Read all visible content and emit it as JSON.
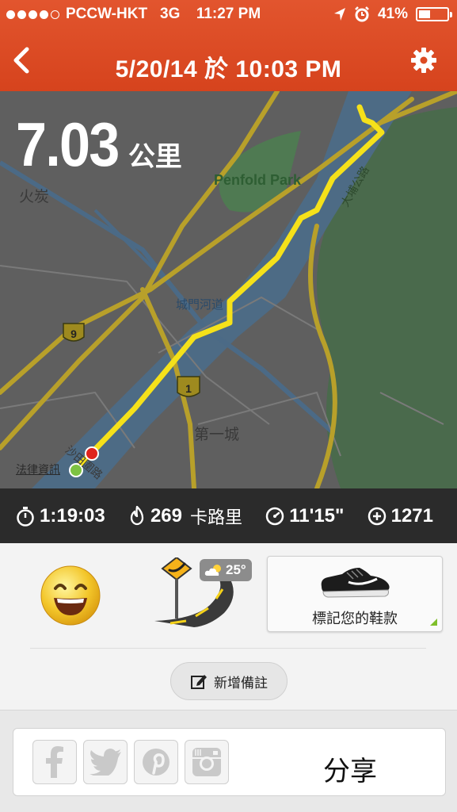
{
  "status_bar": {
    "carrier": "PCCW-HKT",
    "network": "3G",
    "time": "11:27 PM",
    "battery": "41%",
    "battery_level": 0.41,
    "signal_bars": 4,
    "icons": [
      "location-arrow-icon",
      "alarm-icon",
      "battery-icon"
    ]
  },
  "header": {
    "title": "5/20/14 於 10:03 PM",
    "back_icon": "chevron-left-icon",
    "settings_icon": "gear-icon",
    "color": "#dd4b24"
  },
  "map": {
    "distance_value": "7.03",
    "distance_unit": "公里",
    "labels": {
      "park": "Penfold Park",
      "area_huotan": "火炭",
      "river": "城門河道",
      "district": "第一城",
      "road_north": "大埔公路",
      "road_south": "沙田圍路",
      "legal": "法律資訊",
      "route_9": "9",
      "route_1": "1"
    },
    "route_color": "#f5e11a",
    "start_color": "#7dc242",
    "end_color": "#e0231c"
  },
  "stats": {
    "duration": "1:19:03",
    "calories": "269",
    "calories_unit": "卡路里",
    "pace": "11'15\"",
    "fuel": "1271",
    "icons": [
      "stopwatch-icon",
      "flame-icon",
      "pace-gauge-icon",
      "fuel-plus-icon"
    ]
  },
  "details": {
    "feeling_icon": "smiley-icon",
    "terrain_icon": "road-terrain-icon",
    "weather_icon": "partly-cloudy-icon",
    "temperature": "25°",
    "shoe_label": "標記您的鞋款",
    "add_note_label": "新增備註"
  },
  "share": {
    "label": "分享",
    "networks": [
      "facebook-icon",
      "twitter-icon",
      "pinterest-icon",
      "instagram-icon"
    ]
  }
}
